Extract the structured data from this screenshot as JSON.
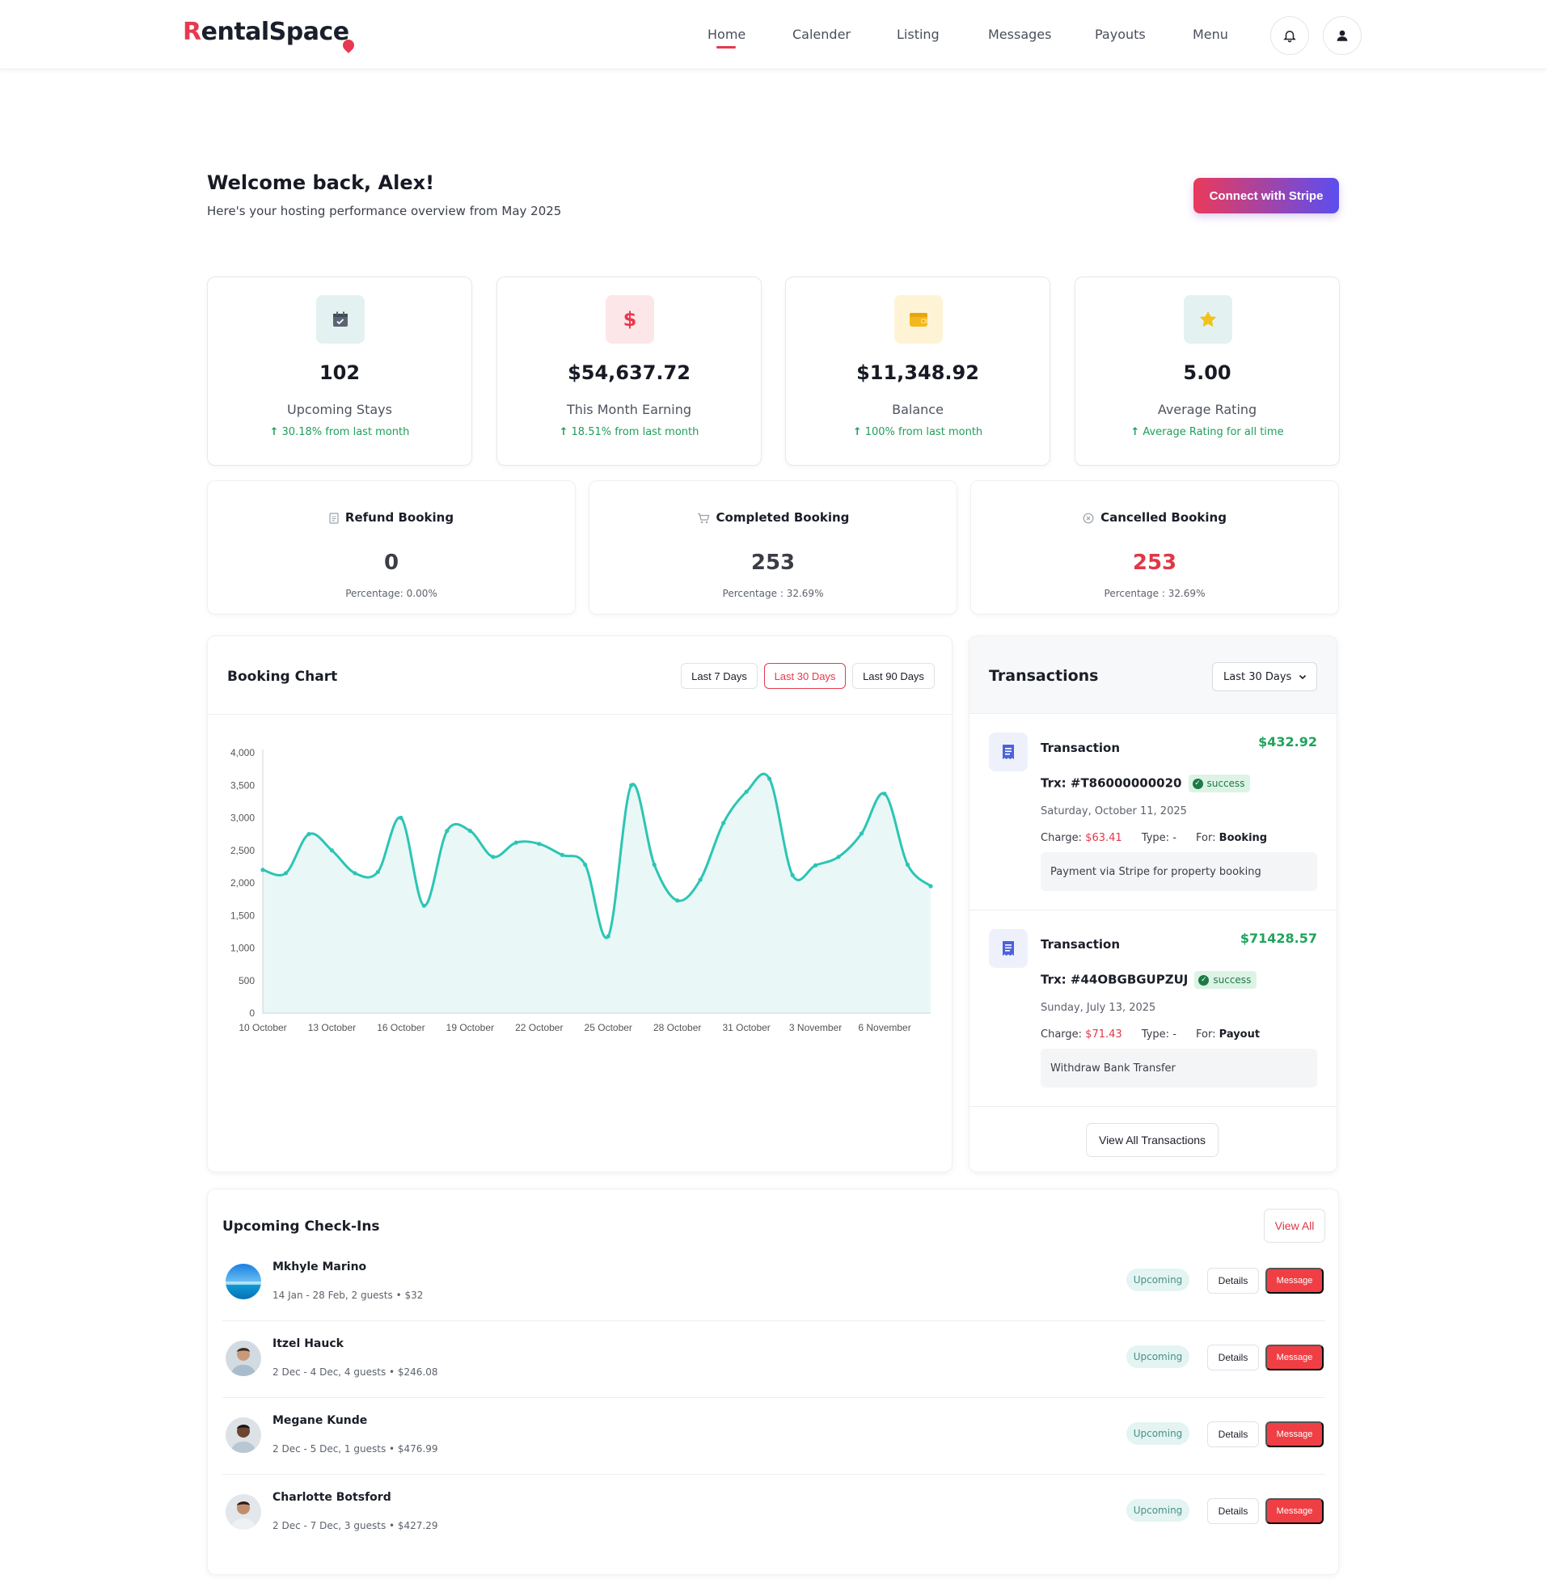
{
  "brand": {
    "logo_first": "R",
    "logo_rest": "entalSpac",
    "logo_last": "e"
  },
  "nav": {
    "items": [
      {
        "label": "Home",
        "active": true
      },
      {
        "label": "Calender"
      },
      {
        "label": "Listing"
      },
      {
        "label": "Messages"
      },
      {
        "label": "Payouts"
      },
      {
        "label": "Menu"
      }
    ],
    "notification_icon": "bell-icon",
    "profile_icon": "user-icon"
  },
  "welcome": {
    "title": "Welcome back, Alex!",
    "subtitle": "Here's your hosting performance overview from May 2025",
    "stripe_button": "Connect with Stripe"
  },
  "stats": [
    {
      "icon": "calendar-check-icon",
      "value": "102",
      "label": "Upcoming Stays",
      "trend": "30.18% from last month",
      "icon_bg": "#e3f2f1",
      "icon_color": "#5a6473"
    },
    {
      "icon": "dollar-icon",
      "value": "$54,637.72",
      "label": "This Month Earning",
      "trend": "18.51% from last month",
      "icon_bg": "#fde6e8",
      "icon_color": "#e8384f"
    },
    {
      "icon": "wallet-icon",
      "value": "$11,348.92",
      "label": "Balance",
      "trend": "100% from last month",
      "icon_bg": "#fff3d6",
      "icon_color": "#f5b81c"
    },
    {
      "icon": "star-icon",
      "value": "5.00",
      "label": "Average Rating",
      "trend": "Average Rating for all time",
      "icon_bg": "#e3f2f1",
      "icon_color": "#f2c21b"
    }
  ],
  "booking_summary": [
    {
      "icon": "receipt-icon",
      "title": "Refund Booking",
      "value": "0",
      "percentage": "Percentage: 0.00%"
    },
    {
      "icon": "cart-icon",
      "title": "Completed Booking",
      "value": "253",
      "percentage": "Percentage : 32.69%"
    },
    {
      "icon": "cancel-circle-icon",
      "title": "Cancelled Booking",
      "value": "253",
      "percentage": "Percentage : 32.69%"
    }
  ],
  "booking_chart": {
    "title": "Booking Chart",
    "ranges": [
      {
        "label": "Last 7 Days"
      },
      {
        "label": "Last 30 Days",
        "active": true
      },
      {
        "label": "Last 90 Days"
      }
    ]
  },
  "chart_data": {
    "type": "area",
    "title": "Booking Chart",
    "xlabel": "",
    "ylabel": "",
    "ylim": [
      0,
      4000
    ],
    "yticks": [
      "0",
      "500",
      "1,000",
      "1,500",
      "2,000",
      "2,500",
      "3,000",
      "3,500",
      "4,000"
    ],
    "categories": [
      "10 October",
      "11 October",
      "12 October",
      "13 October",
      "14 October",
      "15 October",
      "16 October",
      "17 October",
      "18 October",
      "19 October",
      "20 October",
      "21 October",
      "22 October",
      "23 October",
      "24 October",
      "25 October",
      "26 October",
      "27 October",
      "28 October",
      "29 October",
      "30 October",
      "31 October",
      "1 November",
      "2 November",
      "3 November",
      "4 November",
      "5 November",
      "6 November",
      "7 November",
      "8 November"
    ],
    "tick_labels": [
      "10 October",
      "13 October",
      "16 October",
      "19 October",
      "22 October",
      "25 October",
      "28 October",
      "31 October",
      "3 November",
      "6 November"
    ],
    "values": [
      2200,
      2150,
      2750,
      2500,
      2150,
      2170,
      3000,
      1650,
      2800,
      2800,
      2400,
      2620,
      2600,
      2430,
      2280,
      1180,
      3500,
      2280,
      1730,
      2050,
      2920,
      3400,
      3600,
      2120,
      2270,
      2400,
      2760,
      3370,
      2280,
      1950
    ],
    "color": "#2cc5b4",
    "fill": "#e9f8f6",
    "grid": false
  },
  "transactions": {
    "title": "Transactions",
    "filter": "Last 30 Days",
    "items": [
      {
        "name": "Transaction",
        "amount": "$432.92",
        "trx": "Trx: #T86000000020",
        "status": "success",
        "date": "Saturday, October 11, 2025",
        "charge_label": "Charge:",
        "charge": "$63.41",
        "type_label": "Type:",
        "type": "-",
        "for_label": "For:",
        "for": "Booking",
        "description": "Payment via Stripe for property booking"
      },
      {
        "name": "Transaction",
        "amount": "$71428.57",
        "trx": "Trx: #44OBGBGUPZUJ",
        "status": "success",
        "date": "Sunday, July 13, 2025",
        "charge_label": "Charge:",
        "charge": "$71.43",
        "type_label": "Type:",
        "type": "-",
        "for_label": "For:",
        "for": "Payout",
        "description": "Withdraw Bank Transfer"
      }
    ],
    "view_all": "View All Transactions"
  },
  "checkins": {
    "title": "Upcoming Check-Ins",
    "view_all": "View All",
    "rows": [
      {
        "name": "Mkhyle Marino",
        "details": "14 Jan - 28 Feb, 2 guests • $32",
        "status": "Upcoming",
        "details_btn": "Details",
        "message_btn": "Message",
        "avatar": "landscape-avatar"
      },
      {
        "name": "Itzel Hauck",
        "details": "2 Dec - 4 Dec, 4 guests • $246.08",
        "status": "Upcoming",
        "details_btn": "Details",
        "message_btn": "Message",
        "avatar": "person-avatar"
      },
      {
        "name": "Megane Kunde",
        "details": "2 Dec - 5 Dec, 1 guests • $476.99",
        "status": "Upcoming",
        "details_btn": "Details",
        "message_btn": "Message",
        "avatar": "person-avatar"
      },
      {
        "name": "Charlotte Botsford",
        "details": "2 Dec - 7 Dec, 3 guests • $427.29",
        "status": "Upcoming",
        "details_btn": "Details",
        "message_btn": "Message",
        "avatar": "person-avatar"
      }
    ]
  }
}
